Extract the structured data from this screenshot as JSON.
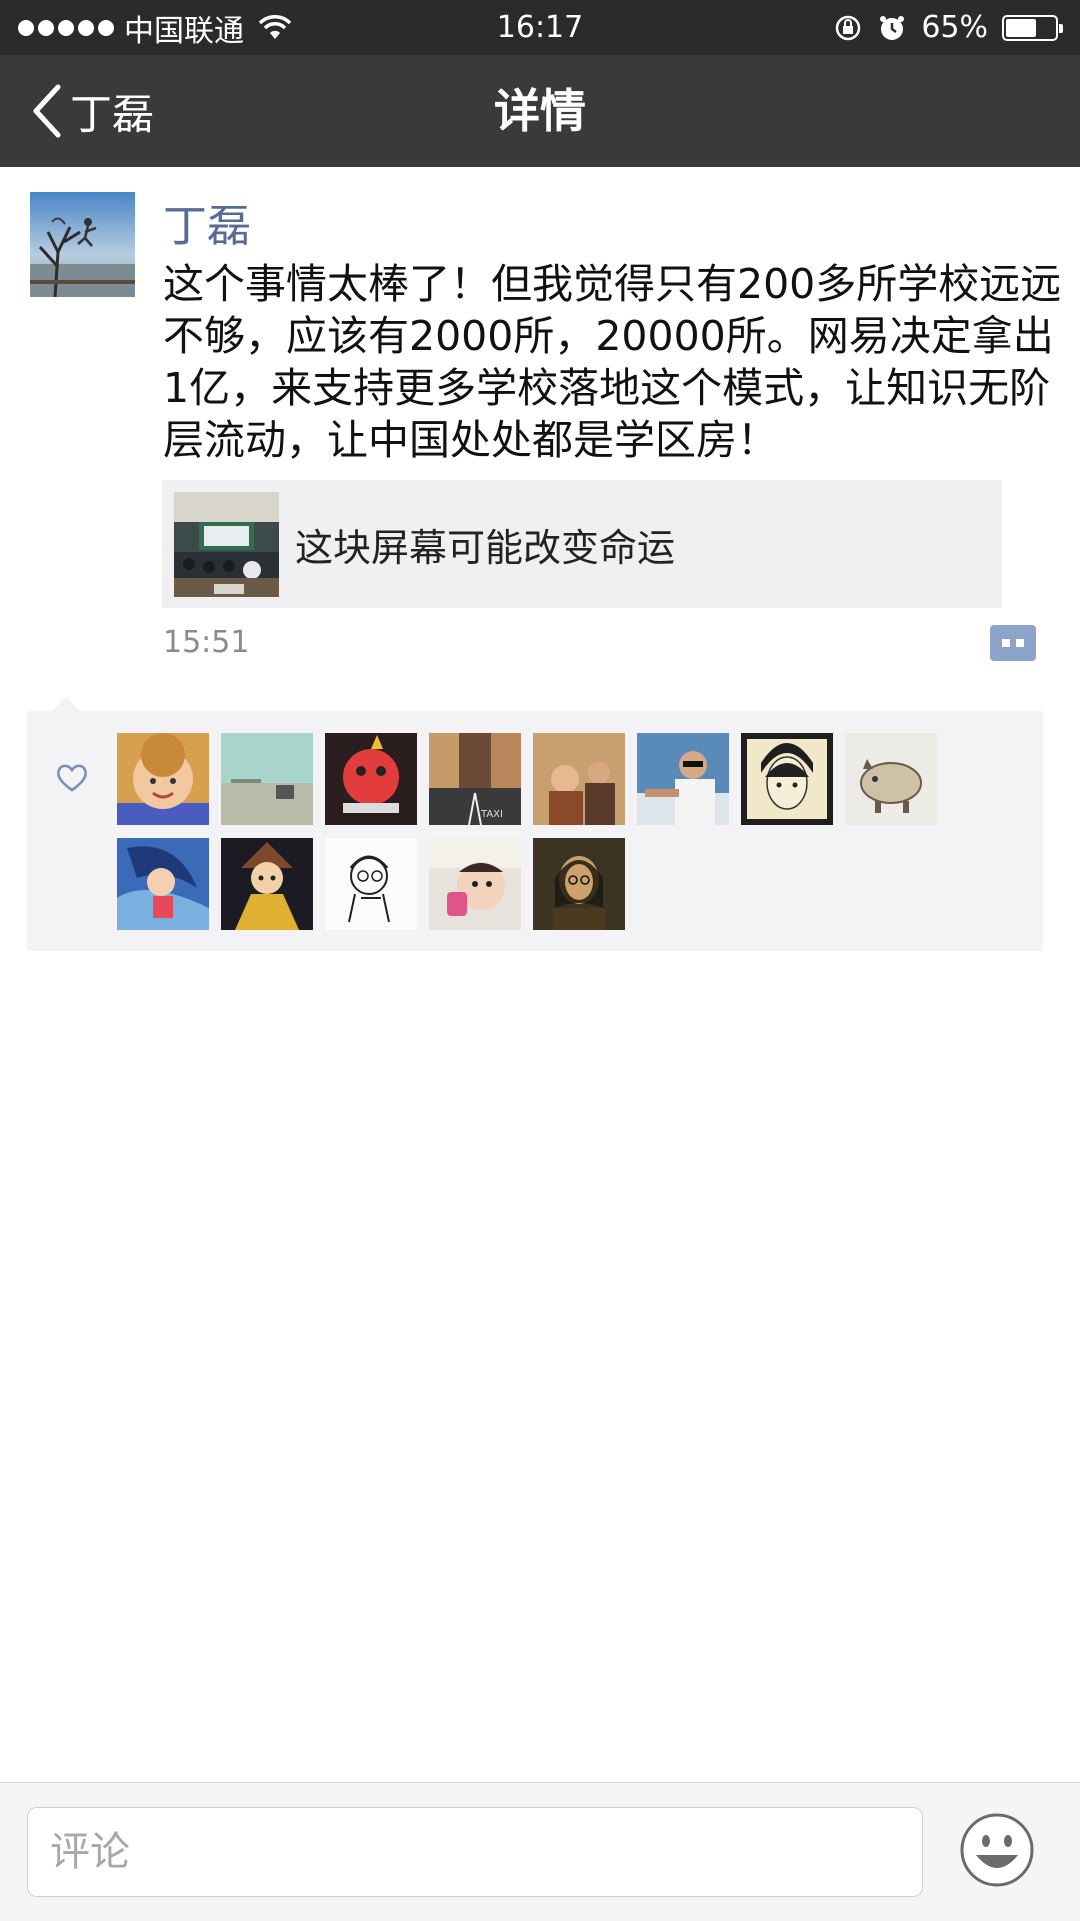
{
  "status_bar": {
    "carrier": "中国联通",
    "time": "16:17",
    "battery_percent_label": "65%",
    "battery_level": 0.65,
    "icons": [
      "signal-dots-icon",
      "wifi-icon",
      "orientation-lock-icon",
      "alarm-icon",
      "battery-icon"
    ]
  },
  "nav": {
    "back_label": "丁磊",
    "title": "详情"
  },
  "post": {
    "author": "丁磊",
    "text": "这个事情太棒了！但我觉得只有200多所学校远远不够，应该有2000所，20000所。网易决定拿出1亿，来支持更多学校落地这个模式，让知识无阶层流动，让中国处处都是学区房！",
    "link": {
      "title": "这块屏幕可能改变命运"
    },
    "time": "15:51"
  },
  "likes": {
    "icon": "heart-icon",
    "count": 13
  },
  "comment_bar": {
    "placeholder": "评论",
    "emoji_icon": "smiley-face-icon"
  },
  "colors": {
    "status_bar_bg": "#2b2b2e",
    "nav_bar_bg": "#3a3a3d",
    "author_name": "#576b95",
    "likes_bg": "#f3f3f5",
    "comment_button": "#8ea3c9"
  }
}
